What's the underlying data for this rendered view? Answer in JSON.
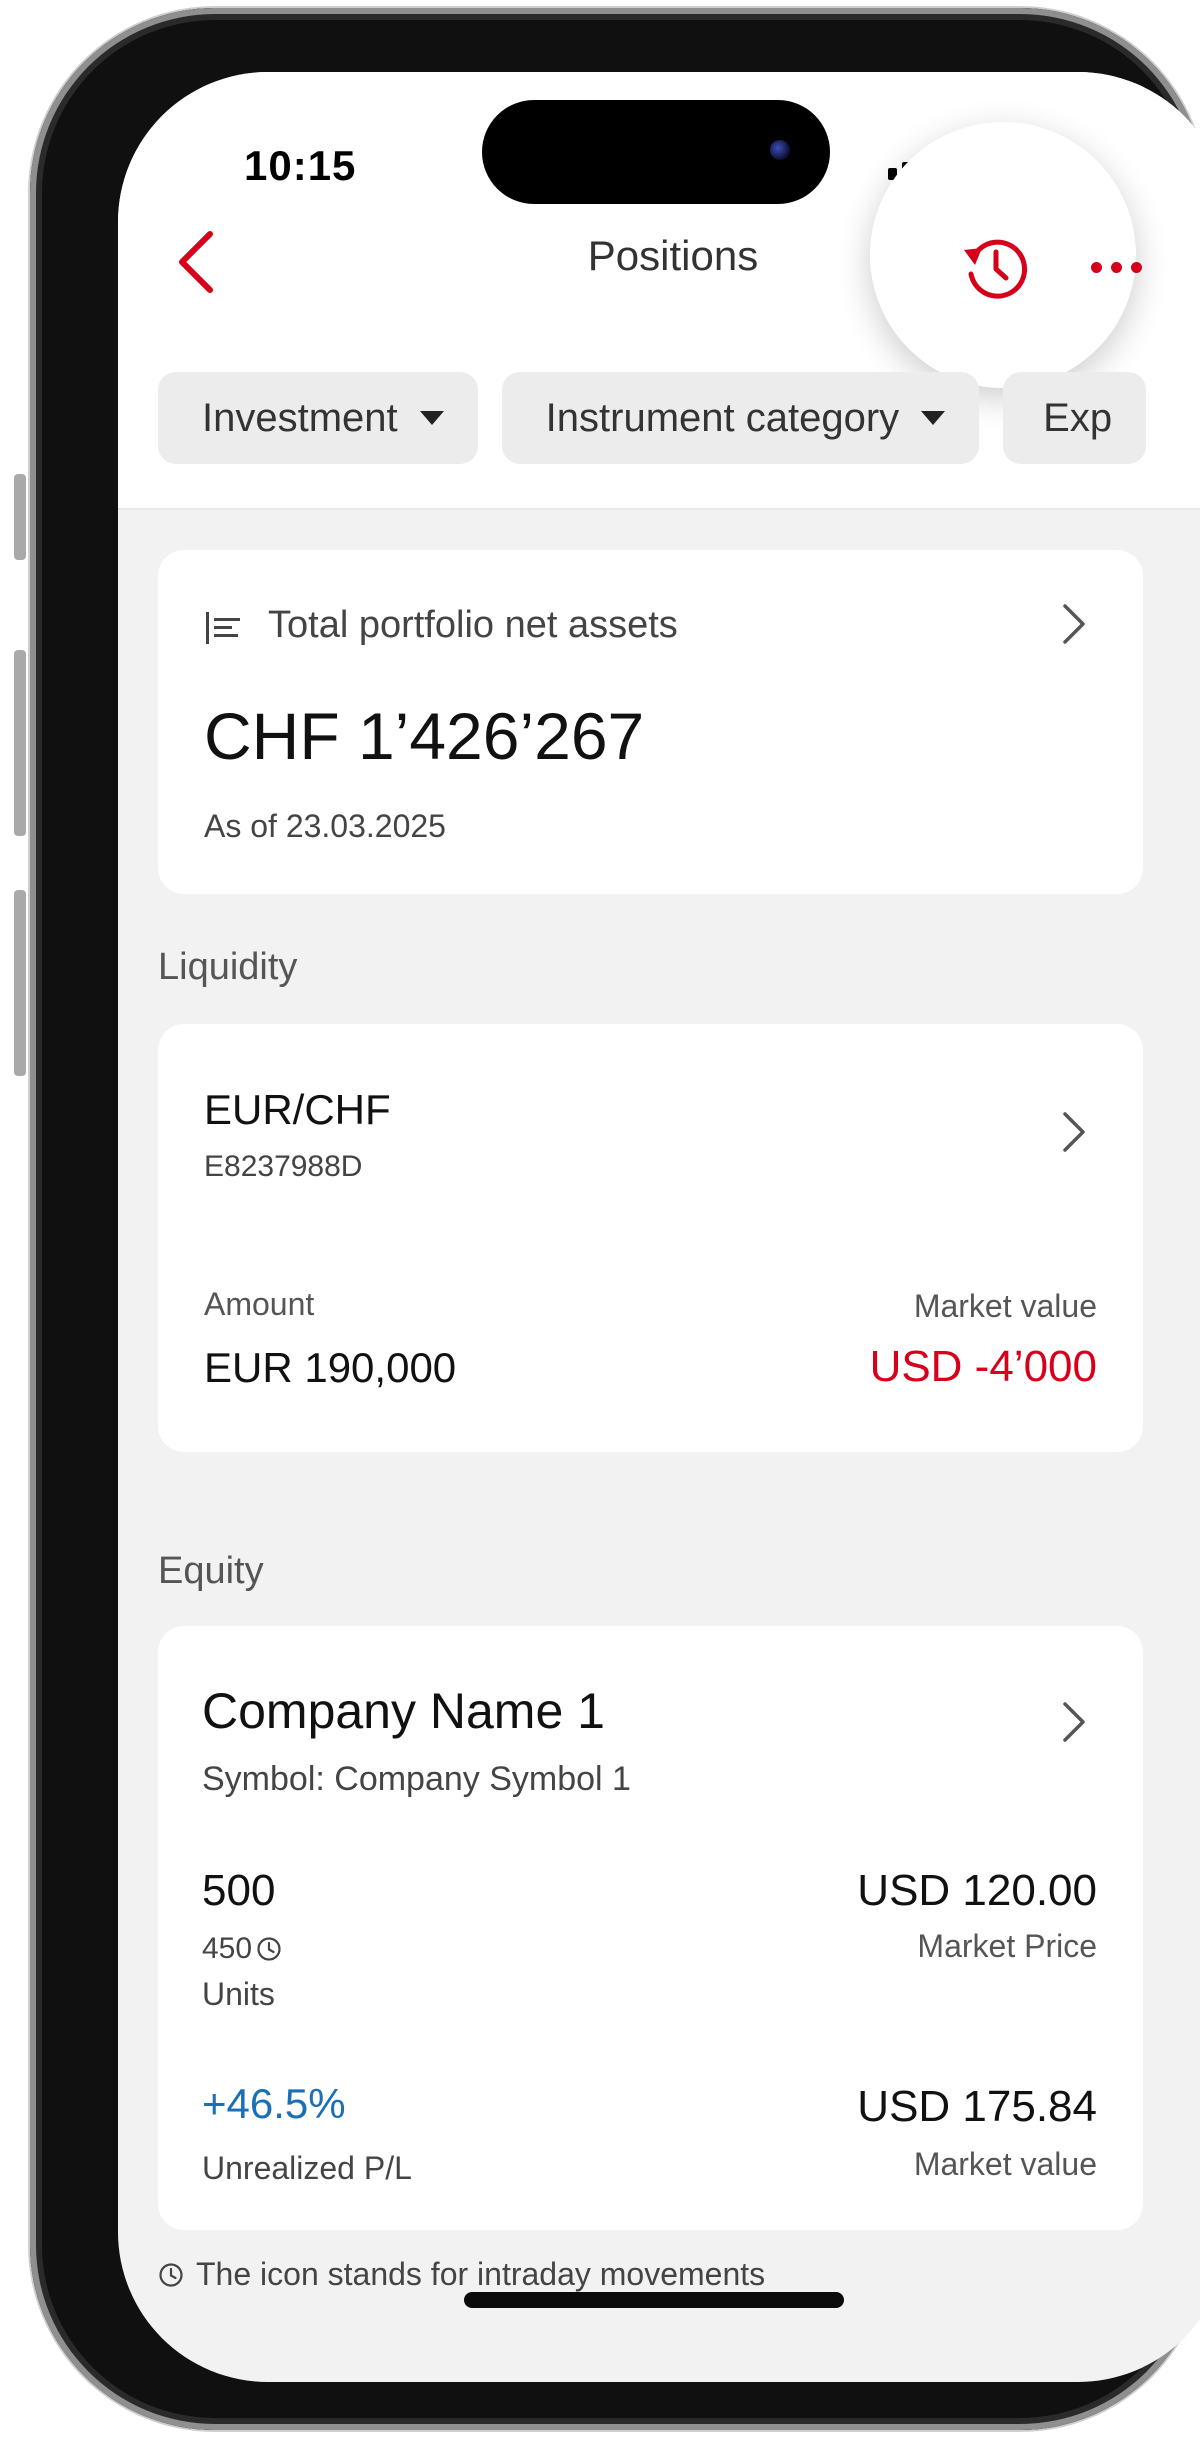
{
  "status_bar": {
    "time": "10:15"
  },
  "header": {
    "title": "Positions"
  },
  "filters": [
    {
      "label": "Investment"
    },
    {
      "label": "Instrument category"
    },
    {
      "label": "Exp"
    }
  ],
  "summary": {
    "title": "Total portfolio net assets",
    "value": "CHF 1’426’267",
    "as_of": "As of 23.03.2025"
  },
  "liquidity": {
    "section_title": "Liquidity",
    "item": {
      "name": "EUR/CHF",
      "id": "E8237988D",
      "amount_label": "Amount",
      "amount_value": "EUR 190,000",
      "market_value_label": "Market value",
      "market_value": "USD -4’000"
    }
  },
  "equity": {
    "section_title": "Equity",
    "item": {
      "name": "Company Name 1",
      "symbol": "Symbol: Company Symbol 1",
      "units_value": "500",
      "units_intraday": "450",
      "units_label": "Units",
      "price_value": "USD 120.00",
      "price_label": "Market Price",
      "pl_value": "+46.5%",
      "pl_label": "Unrealized P/L",
      "market_value": "USD 175.84",
      "market_value_label": "Market value"
    }
  },
  "footnote": "The icon stands for intraday movements",
  "colors": {
    "accent": "#d7001b",
    "positive": "#1a6fb5",
    "negative": "#d7001b",
    "background": "#f2f2f2",
    "card": "#ffffff"
  }
}
